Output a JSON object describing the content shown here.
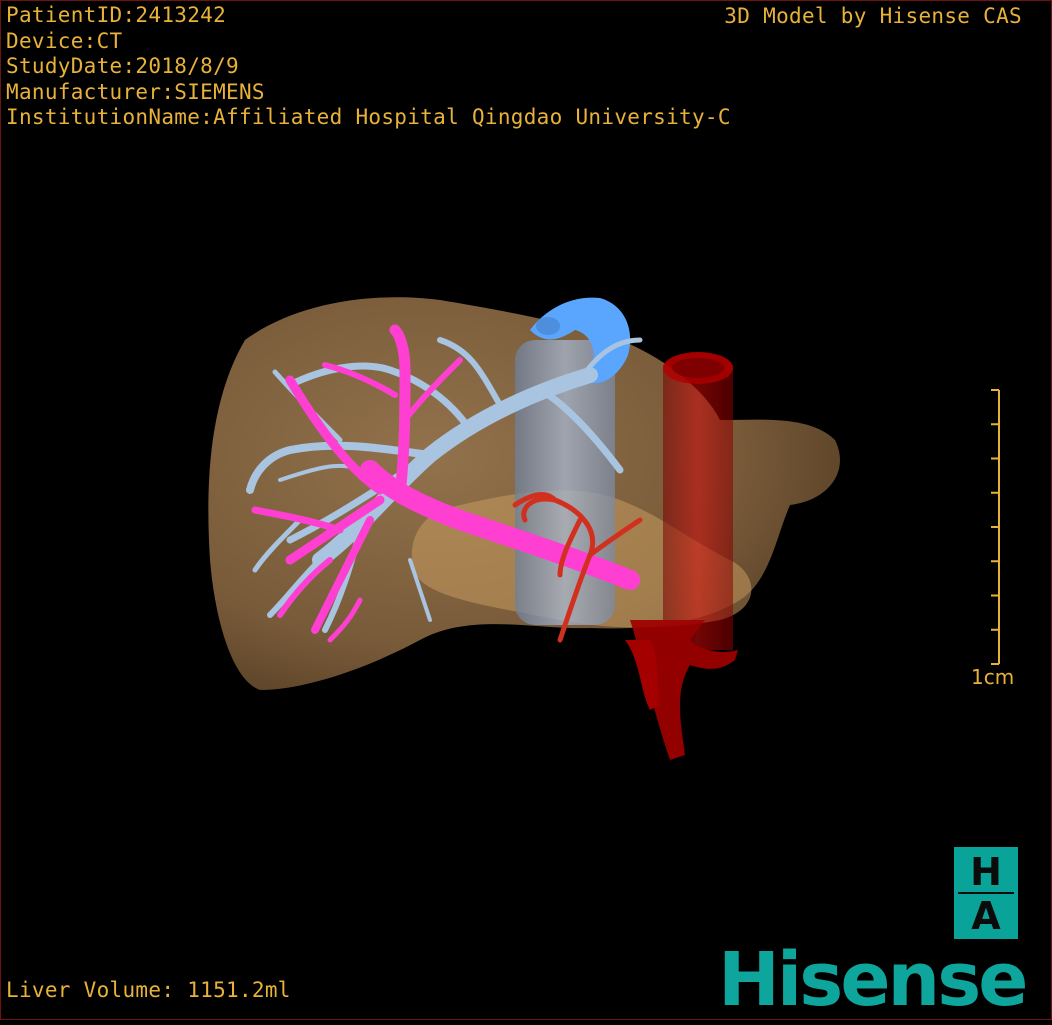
{
  "header": {
    "patient_id": "PatientID:2413242",
    "device": "Device:CT",
    "study_date": "StudyDate:2018/8/9",
    "manufacturer": "Manufacturer:SIEMENS",
    "institution": "InstitutionName:Affiliated Hospital Qingdao University-C"
  },
  "brand_caption": "3D Model by Hisense CAS",
  "footer": {
    "liver_volume": "Liver Volume: 1151.2ml"
  },
  "scale": {
    "label": "1cm",
    "ticks": 8
  },
  "logo": {
    "ha_top": "H",
    "ha_bottom": "A",
    "wordmark": "Hisense"
  },
  "colors": {
    "text": "#e8b23a",
    "liver": "#8a6a45",
    "portal_vein": "#ff3fd2",
    "hepatic_vein": "#a9c4e0",
    "ivc": "#5aa6ff",
    "aorta": "#c40000",
    "artery": "#d2301f",
    "brand": "#0ea59c"
  },
  "icons": [
    "liver-3d-model",
    "scale-bar",
    "ha-logo",
    "hisense-logo"
  ]
}
